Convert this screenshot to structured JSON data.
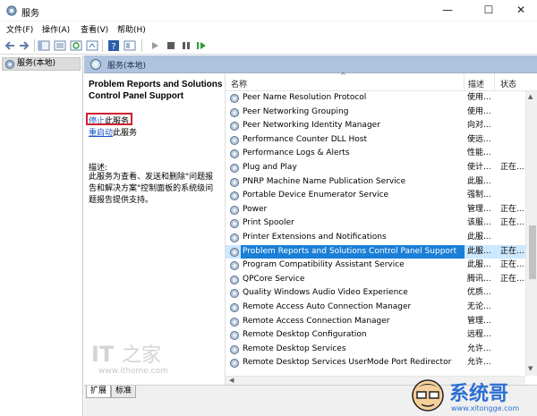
{
  "window": {
    "title": "服务"
  },
  "menu": [
    "文件(F)",
    "操作(A)",
    "查看(V)",
    "帮助(H)"
  ],
  "tree": {
    "item": "服务(本地)"
  },
  "content_header": "服务(本地)",
  "selected_service": {
    "title": "Problem Reports and Solutions Control Panel Support",
    "stop_link": "停止",
    "stop_suffix": "此服务",
    "restart_link": "重启动",
    "restart_suffix": "此服务",
    "description_label": "描述:",
    "description": "此服务为查看、发送和删除\"问题报告和解决方案\"控制面板的系统级问题报告提供支持。"
  },
  "columns": {
    "name": "名称",
    "description": "描述",
    "status": "状态"
  },
  "services": [
    {
      "name": "Peer Name Resolution Protocol",
      "desc": "使用...",
      "status": ""
    },
    {
      "name": "Peer Networking Grouping",
      "desc": "使用...",
      "status": ""
    },
    {
      "name": "Peer Networking Identity Manager",
      "desc": "向对...",
      "status": ""
    },
    {
      "name": "Performance Counter DLL Host",
      "desc": "使远...",
      "status": ""
    },
    {
      "name": "Performance Logs & Alerts",
      "desc": "性能...",
      "status": ""
    },
    {
      "name": "Plug and Play",
      "desc": "使计...",
      "status": "正在..."
    },
    {
      "name": "PNRP Machine Name Publication Service",
      "desc": "此服...",
      "status": ""
    },
    {
      "name": "Portable Device Enumerator Service",
      "desc": "强制...",
      "status": ""
    },
    {
      "name": "Power",
      "desc": "管理...",
      "status": "正在..."
    },
    {
      "name": "Print Spooler",
      "desc": "该服...",
      "status": "正在..."
    },
    {
      "name": "Printer Extensions and Notifications",
      "desc": "此服...",
      "status": ""
    },
    {
      "name": "Problem Reports and Solutions Control Panel Support",
      "desc": "此服...",
      "status": "正在..."
    },
    {
      "name": "Program Compatibility Assistant Service",
      "desc": "此服...",
      "status": "正在..."
    },
    {
      "name": "QPCore Service",
      "desc": "腾讯...",
      "status": "正在..."
    },
    {
      "name": "Quality Windows Audio Video Experience",
      "desc": "优质...",
      "status": ""
    },
    {
      "name": "Remote Access Auto Connection Manager",
      "desc": "无论...",
      "status": ""
    },
    {
      "name": "Remote Access Connection Manager",
      "desc": "管理...",
      "status": ""
    },
    {
      "name": "Remote Desktop Configuration",
      "desc": "远程...",
      "status": ""
    },
    {
      "name": "Remote Desktop Services",
      "desc": "允许...",
      "status": ""
    },
    {
      "name": "Remote Desktop Services UserMode Port Redirector",
      "desc": "允许...",
      "status": ""
    }
  ],
  "selected_index": 11,
  "tabs": [
    "扩展",
    "标准"
  ],
  "watermark": {
    "brand": "IT之家",
    "url": "www.ithome.com"
  },
  "logo": {
    "name": "系统哥",
    "url": "www.xitongge.com"
  },
  "colors": {
    "header_bg": "#aec3dd",
    "selection": "#1a7fd6",
    "link": "#1a52c4",
    "highlight_box": "#d2202e"
  }
}
